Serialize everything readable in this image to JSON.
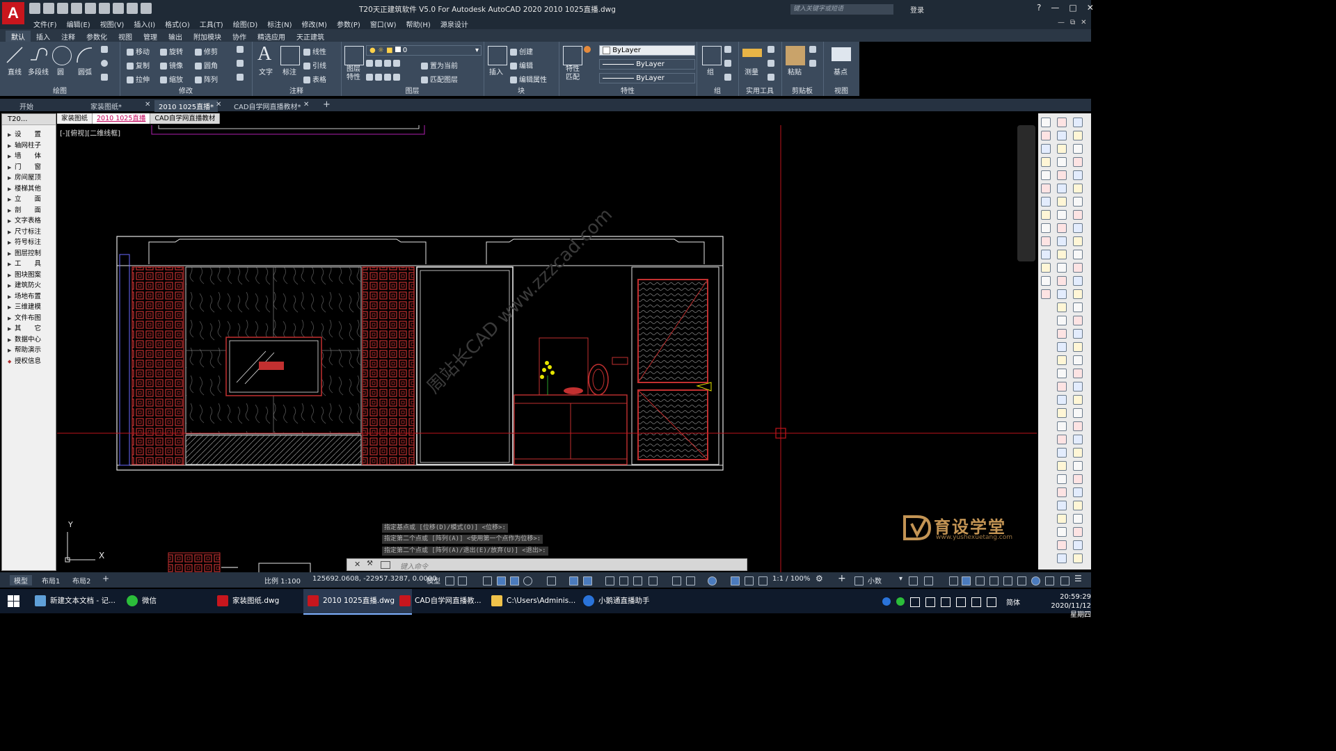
{
  "window": {
    "title": "T20天正建筑软件 V5.0 For Autodesk AutoCAD 2020    2010 1025直播.dwg",
    "app_logo": "A",
    "search_placeholder": "键入关键字或短语",
    "login": "登录"
  },
  "menu": [
    "文件(F)",
    "编辑(E)",
    "视图(V)",
    "插入(I)",
    "格式(O)",
    "工具(T)",
    "绘图(D)",
    "标注(N)",
    "修改(M)",
    "参数(P)",
    "窗口(W)",
    "帮助(H)",
    "源泉设计"
  ],
  "ribbon_tabs": [
    "默认",
    "插入",
    "注释",
    "参数化",
    "视图",
    "管理",
    "输出",
    "附加模块",
    "协作",
    "精选应用",
    "天正建筑"
  ],
  "ribbon": {
    "draw": {
      "title": "绘图",
      "line": "直线",
      "polyline": "多段线",
      "circle": "圆",
      "arc": "圆弧"
    },
    "modify": {
      "title": "修改",
      "move": "移动",
      "rotate": "旋转",
      "trim": "修剪",
      "copy": "复制",
      "mirror": "镜像",
      "fillet": "圆角",
      "stretch": "拉伸",
      "scale": "缩放",
      "array": "阵列"
    },
    "annotation": {
      "title": "注释",
      "text": "文字",
      "dimension": "标注",
      "linear": "线性",
      "leader": "引线",
      "table": "表格"
    },
    "layers": {
      "title": "图层",
      "layer_props": "图层特性",
      "current_layer": "0",
      "make_current": "置为当前",
      "match_layer": "匹配图层"
    },
    "block": {
      "title": "块",
      "insert": "插入",
      "create": "创建",
      "edit": "编辑",
      "edit_attr": "编辑属性"
    },
    "properties": {
      "title": "特性",
      "match": "特性匹配",
      "color": "ByLayer",
      "linetype": "ByLayer",
      "lineweight": "ByLayer"
    },
    "groups": {
      "title": "组",
      "group": "组"
    },
    "utilities": {
      "title": "实用工具",
      "measure": "测量"
    },
    "clipboard": {
      "title": "剪贴板",
      "paste": "粘贴"
    },
    "view": {
      "title": "视图",
      "base": "基点"
    }
  },
  "doc_tabs": [
    "开始",
    "家装图纸*",
    "2010 1025直播*",
    "CAD自学网直播教材*"
  ],
  "inner_tabs": [
    "家装图纸",
    "2010 1025直播",
    "CAD自学网直播教材"
  ],
  "left_palette": {
    "header": "T20...",
    "items": [
      "设　　置",
      "轴网柱子",
      "墙　　体",
      "门　　窗",
      "房间屋顶",
      "楼梯其他",
      "立　　面",
      "剖　　面",
      "文字表格",
      "尺寸标注",
      "符号标注",
      "图层控制",
      "工　　具",
      "图块图案",
      "建筑防火",
      "场地布置",
      "三维建模",
      "文件布图",
      "其　　它",
      "数据中心",
      "帮助演示",
      "授权信息"
    ]
  },
  "viewport_label": "[-][俯视][二维线框]",
  "command_history": [
    "指定基点或 [位移(D)/模式(O)] <位移>:",
    "指定第二个点或 [阵列(A)] <使用第一个点作为位移>:",
    "指定第二个点或 [阵列(A)/退出(E)/放弃(U)] <退出>:"
  ],
  "command_placeholder": "键入命令",
  "ucs": {
    "x": "X",
    "y": "Y"
  },
  "brand": {
    "name": "育设学堂",
    "url": "www.yushexuetang.com"
  },
  "status": {
    "layout_tabs": [
      "模型",
      "布局1",
      "布局2"
    ],
    "scale": "比例 1:100",
    "coords": "125692.0608, -22957.3287, 0.0000",
    "mode": "模型",
    "annoscale": "1:1 / 100%",
    "units": "小数"
  },
  "taskbar": {
    "items": [
      "新建文本文档 - 记...",
      "微信",
      "家装图纸.dwg",
      "2010 1025直播.dwg",
      "CAD自学网直播教...",
      "C:\\Users\\Adminis...",
      "小鹅通直播助手"
    ],
    "ime": "简体",
    "time": "20:59:29",
    "date": "2020/11/12 星期四"
  },
  "colors": {
    "accent": "#c8161d",
    "ribbon_bg": "#3b4a5c",
    "canvas": "#000000",
    "crosshair": "#c0141c",
    "brand": "#c39454"
  }
}
